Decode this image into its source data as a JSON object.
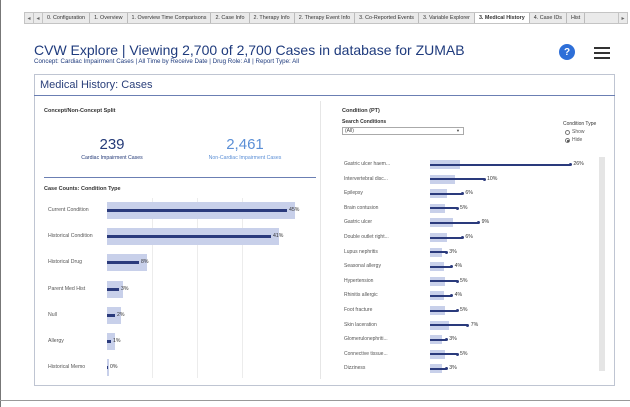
{
  "tabs": [
    "0. Configuration",
    "1. Overview",
    "1. Overview Time Comparisons",
    "2. Case Info",
    "2. Therapy Info",
    "2. Therapy Event Info",
    "3. Co-Reported Events",
    "3. Variable Explorer",
    "3. Medical History",
    "4. Case IDs",
    "Hist"
  ],
  "active_tab": 8,
  "nav": {
    "prev": "◂",
    "next": "▸",
    "first": "◂"
  },
  "header": {
    "title": "CVW Explore | Viewing 2,700 of 2,700 Cases in database for ZUMAB",
    "subtitle": "Concept: Cardiac Impairment Cases  |  All Time by Receive Date  |  Drug Role: All  |  Report Type: All",
    "help": "?"
  },
  "panel_title": "Medical History: Cases",
  "split": {
    "title": "Concept/Non-Concept Split",
    "concept_count": "239",
    "concept_label": "Cardiac Impairment Cases",
    "nonconcept_count": "2,461",
    "nonconcept_label": "Non-Cardiac Impairment Cases",
    "concept_color": "#243a78",
    "nonconcept_color": "#5b8fd6"
  },
  "counts": {
    "title": "Case Counts: Condition Type",
    "rows": [
      {
        "label": "Current Condition",
        "value": 45,
        "text": "45%",
        "bg": 0.47
      },
      {
        "label": "Historical Condition",
        "value": 41,
        "text": "41%",
        "bg": 0.43
      },
      {
        "label": "Historical Drug",
        "value": 8,
        "text": "8%",
        "bg": 0.1
      },
      {
        "label": "Parent Med Hist",
        "value": 3,
        "text": "3%",
        "bg": 0.04
      },
      {
        "label": "Null",
        "value": 2,
        "text": "2%",
        "bg": 0.035
      },
      {
        "label": "Allergy",
        "value": 1,
        "text": "1%",
        "bg": 0.02
      },
      {
        "label": "Historical Memo",
        "value": 0,
        "text": "0%",
        "bg": 0.005
      }
    ]
  },
  "conditions": {
    "title": "Condition (PT)",
    "search_label": "Search Conditions",
    "search_value": "(All)",
    "type_title": "Condition Type",
    "options": [
      {
        "label": "Show",
        "selected": false
      },
      {
        "label": "Hide",
        "selected": true
      }
    ],
    "rows": [
      {
        "label": "Gastric ulcer haem...",
        "value": 26,
        "text": "26%"
      },
      {
        "label": "Intervertebral disc...",
        "value": 10,
        "text": "10%"
      },
      {
        "label": "Epilepsy",
        "value": 6,
        "text": "6%"
      },
      {
        "label": "Brain contusion",
        "value": 5,
        "text": "5%"
      },
      {
        "label": "Gastric ulcer",
        "value": 9,
        "text": "9%"
      },
      {
        "label": "Double outlet right...",
        "value": 6,
        "text": "6%"
      },
      {
        "label": "Lupus nephritis",
        "value": 3,
        "text": "3%"
      },
      {
        "label": "Seasonal allergy",
        "value": 4,
        "text": "4%"
      },
      {
        "label": "Hypertension",
        "value": 5,
        "text": "5%"
      },
      {
        "label": "Rhinitis allergic",
        "value": 4,
        "text": "4%"
      },
      {
        "label": "Foot fracture",
        "value": 5,
        "text": "5%"
      },
      {
        "label": "Skin laceration",
        "value": 7,
        "text": "7%"
      },
      {
        "label": "Glomerulonephriti...",
        "value": 3,
        "text": "3%"
      },
      {
        "label": "Connective tissue...",
        "value": 5,
        "text": "5%"
      },
      {
        "label": "Dizziness",
        "value": 3,
        "text": "3%"
      }
    ]
  },
  "colors": {
    "bar_fg": "#2a3a7c",
    "bar_bg": "#c8d0ea",
    "title_blue": "#1f3b7d",
    "help_blue": "#2e6fd8"
  }
}
